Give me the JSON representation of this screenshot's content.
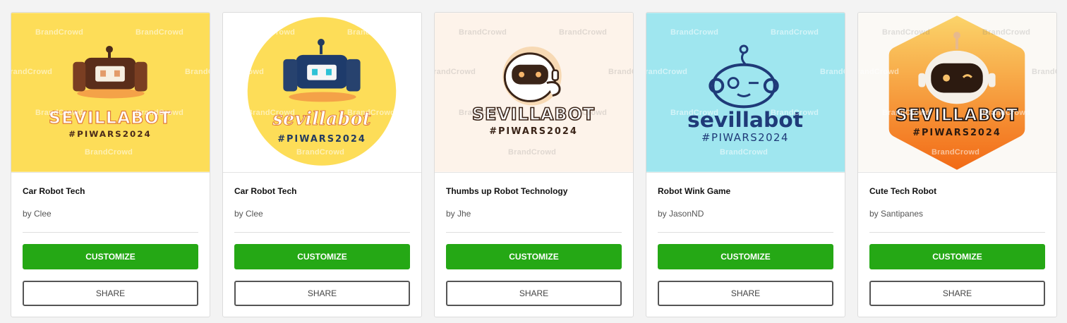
{
  "watermark": "BrandCrowd",
  "colors": {
    "accent_green": "#25a815",
    "card_bg": "#ffffff",
    "page_bg": "#f3f3f3"
  },
  "cards": [
    {
      "title": "Car Robot Tech",
      "author": "by Clee",
      "customize_label": "CUSTOMIZE",
      "share_label": "SHARE",
      "logo": {
        "icon": "car-robot-icon",
        "name": "SEVILLABOT",
        "tag": "#PIWARS2024",
        "bg": "#fddd58"
      }
    },
    {
      "title": "Car Robot Tech",
      "author": "by Clee",
      "customize_label": "CUSTOMIZE",
      "share_label": "SHARE",
      "logo": {
        "icon": "car-robot-icon",
        "name": "sevillabot",
        "tag": "#PIWARS2024",
        "bg": "#fddd58"
      }
    },
    {
      "title": "Thumbs up Robot Technology",
      "author": "by Jhe",
      "customize_label": "CUSTOMIZE",
      "share_label": "SHARE",
      "logo": {
        "icon": "thumbs-up-robot-icon",
        "name": "SEVILLABOT",
        "tag": "#PIWARS2024",
        "bg": "#fdf3ea"
      }
    },
    {
      "title": "Robot Wink Game",
      "author": "by JasonND",
      "customize_label": "CUSTOMIZE",
      "share_label": "SHARE",
      "logo": {
        "icon": "winking-robot-icon",
        "name": "sevillabot",
        "tag": "#PIWARS2024",
        "bg": "#9fe6ef"
      }
    },
    {
      "title": "Cute Tech Robot",
      "author": "by Santipanes",
      "customize_label": "CUSTOMIZE",
      "share_label": "SHARE",
      "logo": {
        "icon": "cute-robot-icon",
        "name": "SEVILLABOT",
        "tag": "#PIWARS2024",
        "bg": "#fbf9f5"
      }
    }
  ]
}
